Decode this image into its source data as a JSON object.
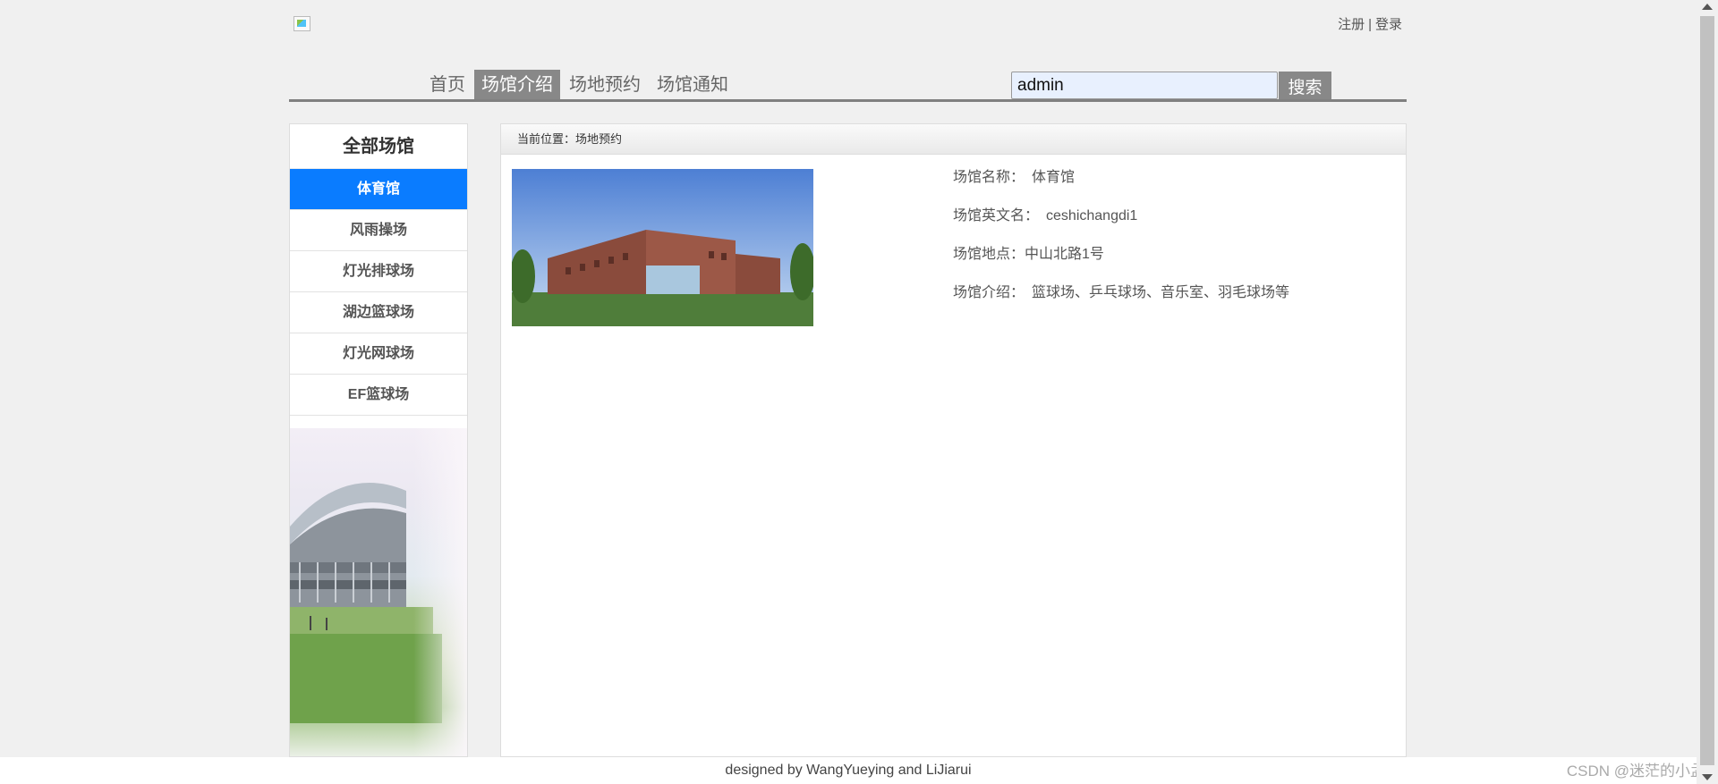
{
  "header": {
    "register_label": "注册",
    "separator": "|",
    "login_label": "登录"
  },
  "nav": {
    "items": [
      {
        "label": "首页"
      },
      {
        "label": "场馆介绍"
      },
      {
        "label": "场地预约"
      },
      {
        "label": "场馆通知"
      }
    ],
    "active_index": 1
  },
  "search": {
    "value": "admin",
    "button_label": "搜索"
  },
  "sidebar": {
    "title": "全部场馆",
    "items": [
      {
        "label": "体育馆"
      },
      {
        "label": "风雨操场"
      },
      {
        "label": "灯光排球场"
      },
      {
        "label": "湖边篮球场"
      },
      {
        "label": "灯光网球场"
      },
      {
        "label": "EF篮球场"
      }
    ],
    "active_index": 0,
    "accent_color": "#0a7cff"
  },
  "main": {
    "breadcrumb": "当前位置：场地预约",
    "venue": {
      "name_label": "场馆名称：",
      "name": "体育馆",
      "english_label": "场馆英文名：",
      "english": "ceshichangdi1",
      "location_label": "场馆地点：",
      "location": "中山北路1号",
      "intro_label": "场馆介绍：",
      "intro": "篮球场、乒乓球场、音乐室、羽毛球场等"
    }
  },
  "footer": {
    "text": "designed by WangYueying and LiJiarui"
  },
  "watermark": "CSDN @迷茫的小孟"
}
